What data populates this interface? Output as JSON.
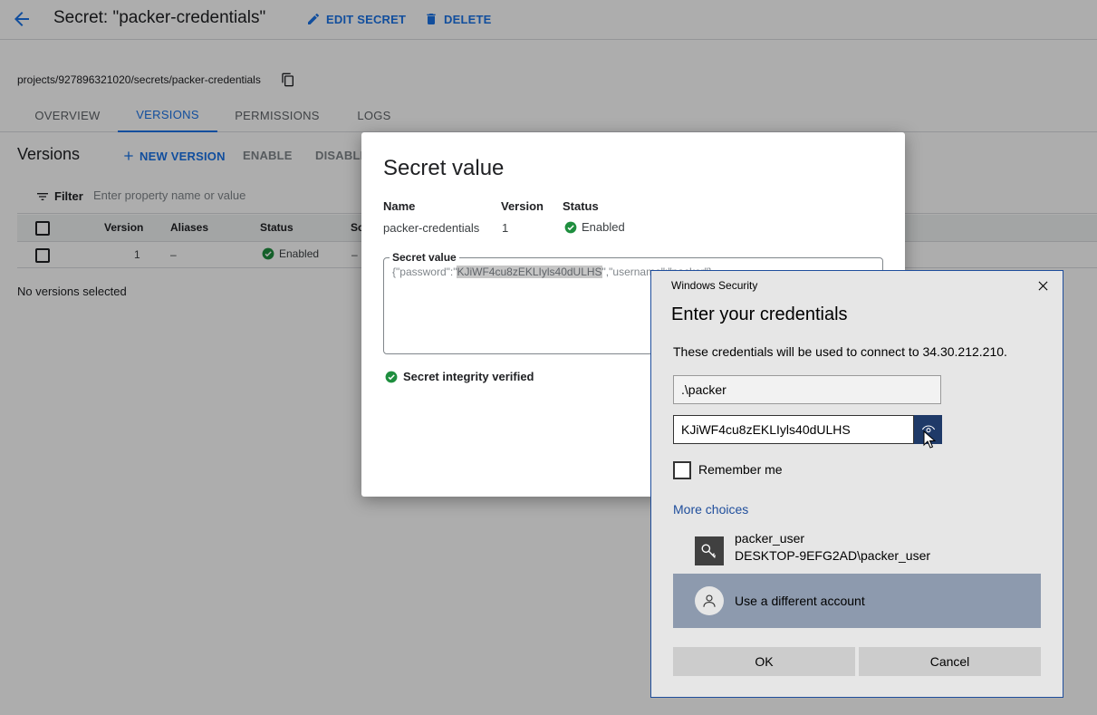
{
  "header": {
    "title": "Secret: \"packer-credentials\"",
    "edit_label": "EDIT SECRET",
    "delete_label": "DELETE"
  },
  "resource_path": "projects/927896321020/secrets/packer-credentials",
  "tabs": [
    {
      "label": "OVERVIEW",
      "active": false
    },
    {
      "label": "VERSIONS",
      "active": true
    },
    {
      "label": "PERMISSIONS",
      "active": false
    },
    {
      "label": "LOGS",
      "active": false
    }
  ],
  "versions": {
    "title": "Versions",
    "new_version_label": "NEW VERSION",
    "enable_label": "ENABLE",
    "disable_label": "DISABLE",
    "filter_label": "Filter",
    "filter_placeholder": "Enter property name or value",
    "columns": [
      "Version",
      "Aliases",
      "Status",
      "Sc"
    ],
    "rows": [
      {
        "version": "1",
        "aliases": "–",
        "status": "Enabled",
        "sc": "–"
      }
    ],
    "empty_selection": "No versions selected"
  },
  "modal": {
    "title": "Secret value",
    "name_label": "Name",
    "version_label": "Version",
    "status_label": "Status",
    "name_value": "packer-credentials",
    "version_value": "1",
    "status_value": "Enabled",
    "field_label": "Secret value",
    "secret_prefix": "{\"password\":\"",
    "secret_highlight": "KJiWF4cu8zEKLIyls40dULHS",
    "secret_suffix": "\",\"username\":\"packer\"}",
    "integrity_label": "Secret integrity verified"
  },
  "win_dialog": {
    "caption": "Windows Security",
    "heading": "Enter your credentials",
    "info": "These credentials will be used to connect to 34.30.212.210.",
    "username_value": ".\\packer",
    "password_value": "KJiWF4cu8zEKLIyls40dULHS",
    "remember_label": "Remember me",
    "remember_checked": false,
    "more_choices": "More choices",
    "saved_account_name": "packer_user",
    "saved_account_sub": "DESKTOP-9EFG2AD\\packer_user",
    "other_account_label": "Use a different account",
    "ok_label": "OK",
    "cancel_label": "Cancel"
  },
  "colors": {
    "accent": "#1a73e8",
    "success": "#1e8e3e",
    "win_accent": "#1f3a68",
    "win_selected": "#8d9aae"
  },
  "icons": [
    "back-arrow-icon",
    "pencil-icon",
    "trash-icon",
    "copy-icon",
    "plus-icon",
    "filter-icon",
    "check-circle-icon",
    "close-icon",
    "eye-icon",
    "key-icon",
    "person-icon",
    "mouse-cursor-icon"
  ]
}
